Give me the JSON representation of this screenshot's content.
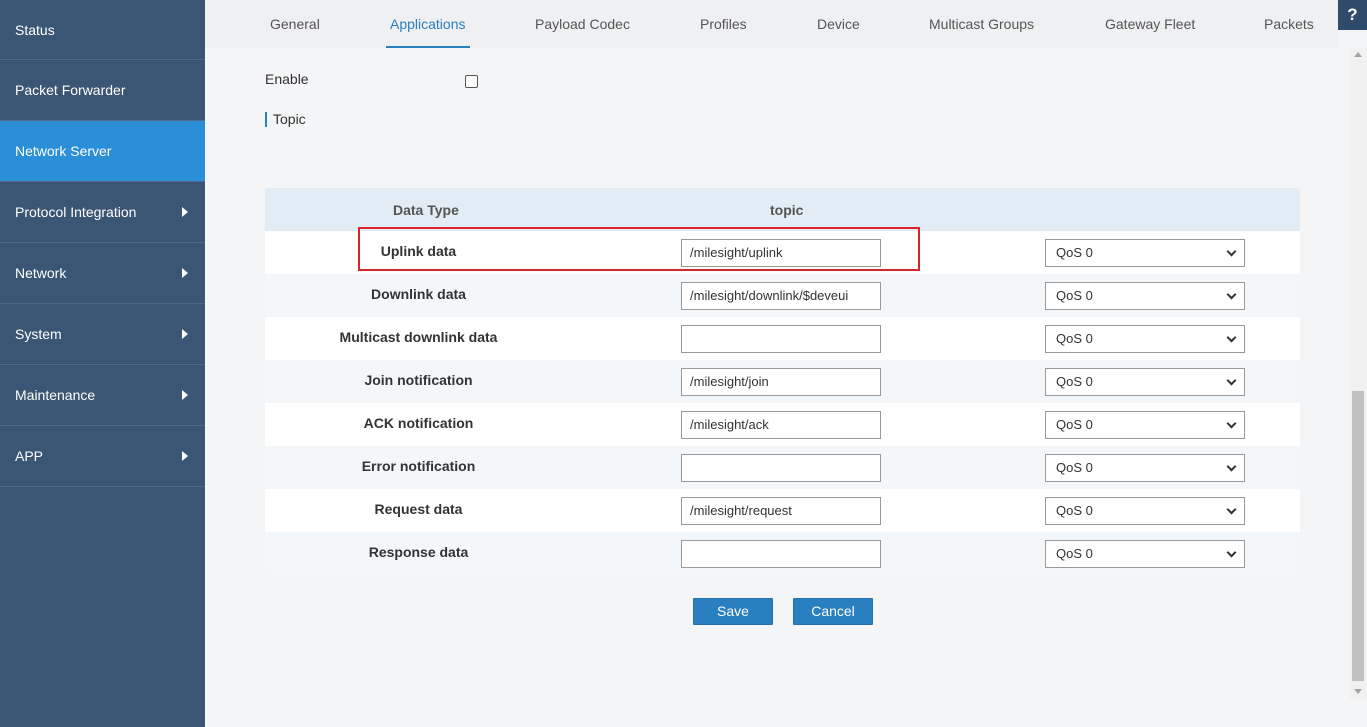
{
  "sidebar": {
    "items": [
      {
        "label": "Status"
      },
      {
        "label": "Packet Forwarder"
      },
      {
        "label": "Network Server"
      },
      {
        "label": "Protocol Integration"
      },
      {
        "label": "Network"
      },
      {
        "label": "System"
      },
      {
        "label": "Maintenance"
      },
      {
        "label": "APP"
      }
    ]
  },
  "tabs": [
    {
      "label": "General"
    },
    {
      "label": "Applications"
    },
    {
      "label": "Payload Codec"
    },
    {
      "label": "Profiles"
    },
    {
      "label": "Device"
    },
    {
      "label": "Multicast Groups"
    },
    {
      "label": "Gateway Fleet"
    },
    {
      "label": "Packets"
    }
  ],
  "help_label": "?",
  "form": {
    "enable_label": "Enable",
    "enable_checked": false,
    "topic_heading": "Topic"
  },
  "table": {
    "headers": {
      "data_type": "Data Type",
      "topic": "topic"
    },
    "rows": [
      {
        "type": "Uplink data",
        "topic": "/milesight/uplink",
        "qos": "QoS 0"
      },
      {
        "type": "Downlink data",
        "topic": "/milesight/downlink/$deveui",
        "qos": "QoS 0"
      },
      {
        "type": "Multicast downlink data",
        "topic": "",
        "qos": "QoS 0"
      },
      {
        "type": "Join notification",
        "topic": "/milesight/join",
        "qos": "QoS 0"
      },
      {
        "type": "ACK notification",
        "topic": "/milesight/ack",
        "qos": "QoS 0"
      },
      {
        "type": "Error notification",
        "topic": "",
        "qos": "QoS 0"
      },
      {
        "type": "Request data",
        "topic": "/milesight/request",
        "qos": "QoS 0"
      },
      {
        "type": "Response data",
        "topic": "",
        "qos": "QoS 0"
      }
    ]
  },
  "buttons": {
    "save": "Save",
    "cancel": "Cancel"
  },
  "colors": {
    "sidebar_bg": "#3b5574",
    "sidebar_active": "#2a8fd6",
    "accent": "#2a7fc0",
    "highlight": "#d9232d"
  }
}
